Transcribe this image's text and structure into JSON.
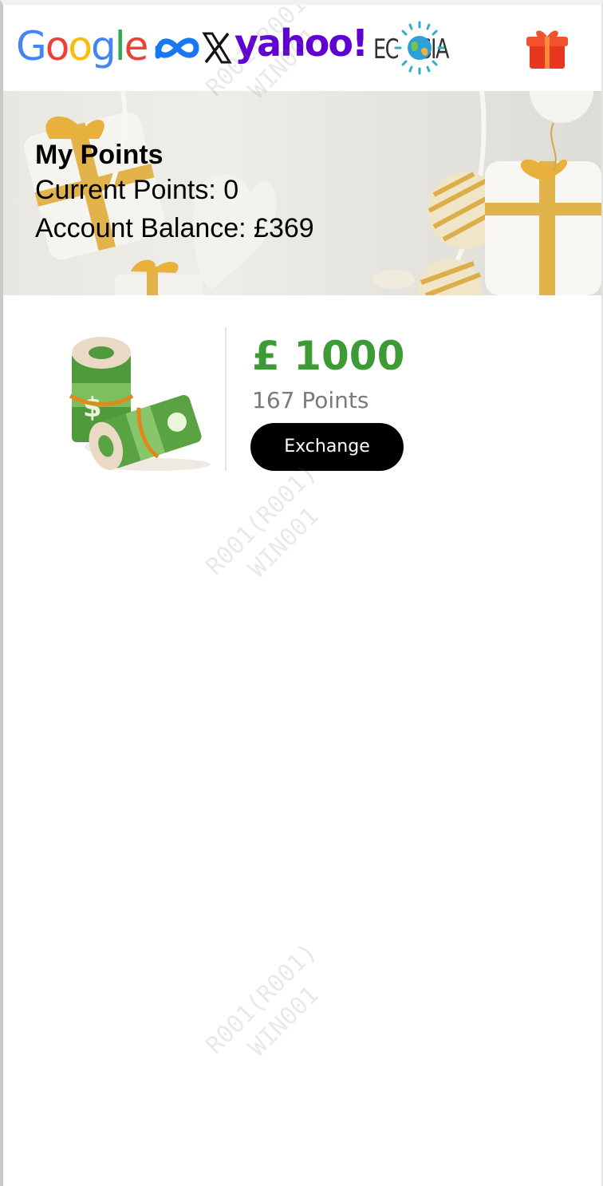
{
  "header": {
    "logos": {
      "google": "Google",
      "meta": "meta-logo",
      "x": "x-logo",
      "yahoo": "yahoo!",
      "ecosia": "ECOSIA"
    },
    "gift_icon": "gift-icon"
  },
  "banner": {
    "title": "My Points",
    "current_points": "Current Points: 0",
    "account_balance": "Account Balance: £369"
  },
  "rewards": [
    {
      "amount": "£ 1000",
      "points": "167 Points",
      "button_label": "Exchange",
      "image_icon": "money-rolls-icon"
    }
  ],
  "watermarks": [
    "R001(R001)",
    "WIN001"
  ],
  "colors": {
    "accent_green": "#3d9b35",
    "button_bg": "#000000",
    "button_text": "#ffffff",
    "yahoo_purple": "#6001d2",
    "gift_red": "#e8361f"
  }
}
